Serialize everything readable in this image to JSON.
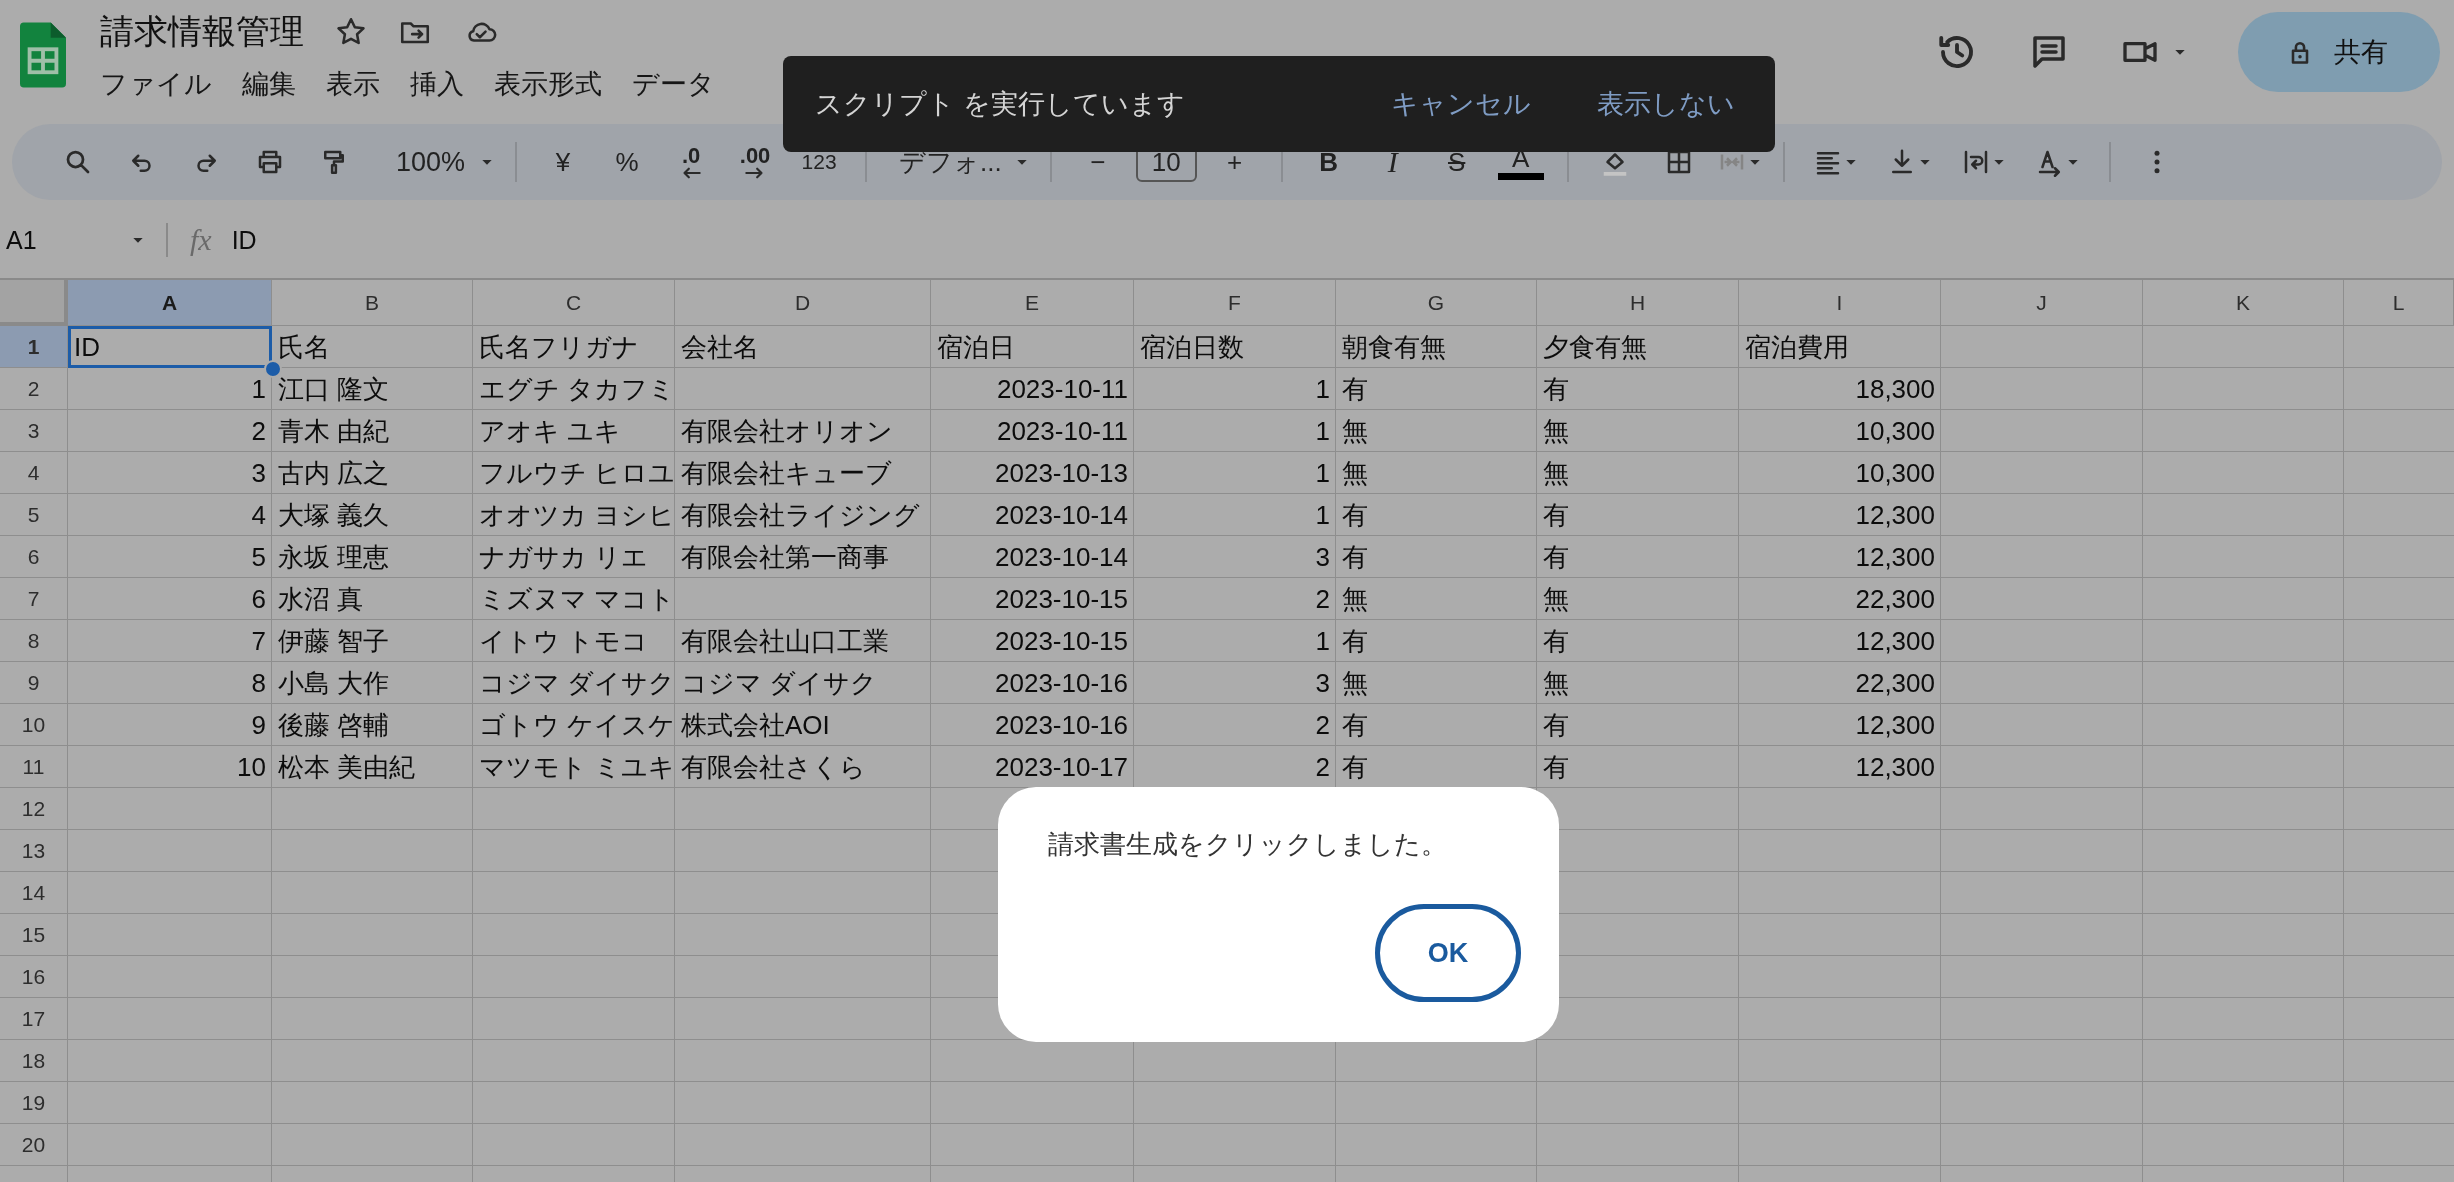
{
  "document": {
    "title": "請求情報管理"
  },
  "menu": [
    "ファイル",
    "編集",
    "表示",
    "挿入",
    "表示形式",
    "データ"
  ],
  "share_button": {
    "label": "共有"
  },
  "toolbar": {
    "zoom": "100%",
    "currency": "¥",
    "percent": "%",
    "decrease_decimals": ".0",
    "increase_decimals": ".00",
    "number_format": "123",
    "font": "デフォ...",
    "font_size": {
      "minus": "−",
      "value": "10",
      "plus": "+"
    },
    "text_styles": [
      "B",
      "I",
      "S",
      "A"
    ]
  },
  "formula_bar": {
    "name_box": "A1",
    "fx": "fx",
    "value": "ID"
  },
  "columns": [
    {
      "label": "A",
      "selected": true,
      "kind": "number"
    },
    {
      "label": "B",
      "selected": false,
      "kind": "text"
    },
    {
      "label": "C",
      "selected": false,
      "kind": "text"
    },
    {
      "label": "D",
      "selected": false,
      "kind": "text"
    },
    {
      "label": "E",
      "selected": false,
      "kind": "number"
    },
    {
      "label": "F",
      "selected": false,
      "kind": "number"
    },
    {
      "label": "G",
      "selected": false,
      "kind": "text"
    },
    {
      "label": "H",
      "selected": false,
      "kind": "text"
    },
    {
      "label": "I",
      "selected": false,
      "kind": "number"
    },
    {
      "label": "J",
      "selected": false,
      "kind": "text"
    },
    {
      "label": "K",
      "selected": false,
      "kind": "text"
    },
    {
      "label": "L",
      "selected": false,
      "kind": "text"
    }
  ],
  "rows": [
    {
      "number": "1",
      "selected": true,
      "kind": "labels",
      "cells": [
        "ID",
        "氏名",
        "氏名フリガナ",
        "会社名",
        "宿泊日",
        "宿泊日数",
        "朝食有無",
        "夕食有無",
        "宿泊費用"
      ]
    },
    {
      "number": "2",
      "selected": false,
      "kind": "data",
      "cells": [
        "1",
        "江口 隆文",
        "エグチ タカフミ",
        null,
        "2023-10-11",
        "1",
        "有",
        "有",
        "18,300"
      ]
    },
    {
      "number": "3",
      "selected": false,
      "kind": "data",
      "cells": [
        "2",
        "青木 由紀",
        "アオキ ユキ",
        "有限会社オリオン",
        "2023-10-11",
        "1",
        "無",
        "無",
        "10,300"
      ]
    },
    {
      "number": "4",
      "selected": false,
      "kind": "data",
      "cells": [
        "3",
        "古内 広之",
        "フルウチ ヒロユ",
        "有限会社キューブ",
        "2023-10-13",
        "1",
        "無",
        "無",
        "10,300"
      ]
    },
    {
      "number": "5",
      "selected": false,
      "kind": "data",
      "cells": [
        "4",
        "大塚 義久",
        "オオツカ ヨシヒ",
        "有限会社ライジング",
        "2023-10-14",
        "1",
        "有",
        "有",
        "12,300"
      ]
    },
    {
      "number": "6",
      "selected": false,
      "kind": "data",
      "cells": [
        "5",
        "永坂 理恵",
        "ナガサカ リエ",
        "有限会社第一商事",
        "2023-10-14",
        "3",
        "有",
        "有",
        "12,300"
      ]
    },
    {
      "number": "7",
      "selected": false,
      "kind": "data",
      "cells": [
        "6",
        "水沼 真",
        "ミズヌマ マコト",
        null,
        "2023-10-15",
        "2",
        "無",
        "無",
        "22,300"
      ]
    },
    {
      "number": "8",
      "selected": false,
      "kind": "data",
      "cells": [
        "7",
        "伊藤 智子",
        "イトウ トモコ",
        "有限会社山口工業",
        "2023-10-15",
        "1",
        "有",
        "有",
        "12,300"
      ]
    },
    {
      "number": "9",
      "selected": false,
      "kind": "data",
      "cells": [
        "8",
        "小島 大作",
        "コジマ ダイサク",
        "コジマ ダイサク",
        "2023-10-16",
        "3",
        "無",
        "無",
        "22,300"
      ]
    },
    {
      "number": "10",
      "selected": false,
      "kind": "data",
      "cells": [
        "9",
        "後藤 啓輔",
        "ゴトウ ケイスケ",
        "株式会社AOI",
        "2023-10-16",
        "2",
        "有",
        "有",
        "12,300"
      ]
    },
    {
      "number": "11",
      "selected": false,
      "kind": "data",
      "cells": [
        "10",
        "松本 美由紀",
        "マツモト ミユキ",
        "有限会社さくら",
        "2023-10-17",
        "2",
        "有",
        "有",
        "12,300"
      ]
    },
    {
      "number": "12",
      "selected": false,
      "kind": "data"
    },
    {
      "number": "13",
      "selected": false,
      "kind": "data"
    },
    {
      "number": "14",
      "selected": false,
      "kind": "data"
    },
    {
      "number": "15",
      "selected": false,
      "kind": "data"
    },
    {
      "number": "16",
      "selected": false,
      "kind": "data"
    },
    {
      "number": "17",
      "selected": false,
      "kind": "data"
    },
    {
      "number": "18",
      "selected": false,
      "kind": "data"
    },
    {
      "number": "19",
      "selected": false,
      "kind": "data"
    },
    {
      "number": "20",
      "selected": false,
      "kind": "data"
    }
  ],
  "snackbar": {
    "message": "スクリプト を実行しています",
    "actions": [
      "キャンセル",
      "表示しない"
    ]
  },
  "dialog": {
    "message": "請求書生成をクリックしました。",
    "button": "OK"
  }
}
